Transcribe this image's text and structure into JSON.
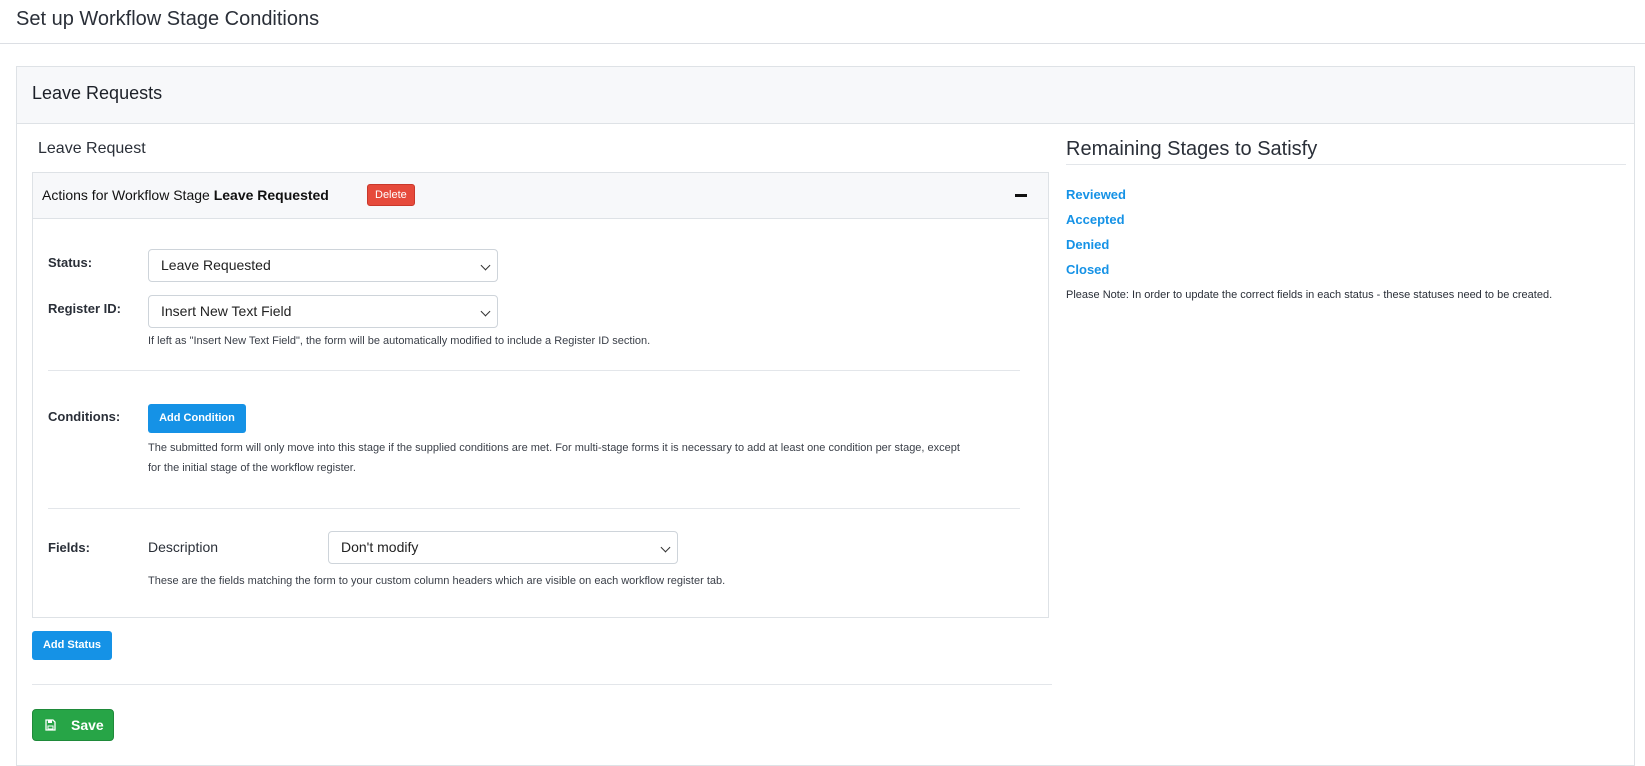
{
  "page": {
    "title": "Set up Workflow Stage Conditions"
  },
  "card": {
    "title": "Leave Requests",
    "form_name": "Leave Request"
  },
  "stage": {
    "header_prefix": "Actions for Workflow Stage ",
    "header_stage": "Leave Requested",
    "delete_label": "Delete",
    "status_label": "Status:",
    "status_value": "Leave Requested",
    "register_label": "Register ID:",
    "register_value": "Insert New Text Field",
    "register_help": "If left as \"Insert New Text Field\", the form will be automatically modified to include a Register ID section.",
    "conditions_label": "Conditions:",
    "add_condition_label": "Add Condition",
    "conditions_help_1": "The submitted form will only move into this stage if the supplied conditions are met. For multi-stage forms it is necessary to add at least one condition per stage, except",
    "conditions_help_2": "for the initial stage of the workflow register.",
    "fields_label": "Fields:",
    "field_name": "Description",
    "field_value": "Don't modify",
    "fields_help": "These are the fields matching the form to your custom column headers which are visible on each workflow register tab."
  },
  "add_status_label": "Add Status",
  "save_label": "Save",
  "remaining": {
    "title": "Remaining Stages to Satisfy",
    "stages": [
      "Reviewed",
      "Accepted",
      "Denied",
      "Closed"
    ],
    "note": "Please Note: In order to update the correct fields in each status - these statuses need to be created."
  },
  "colors": {
    "primary": "#1592e6",
    "danger": "#e64a3b",
    "success": "#27a547"
  },
  "icons": {
    "save": "floppy-disk-icon",
    "collapse": "minus-icon",
    "dropdown": "chevron-down-icon"
  }
}
